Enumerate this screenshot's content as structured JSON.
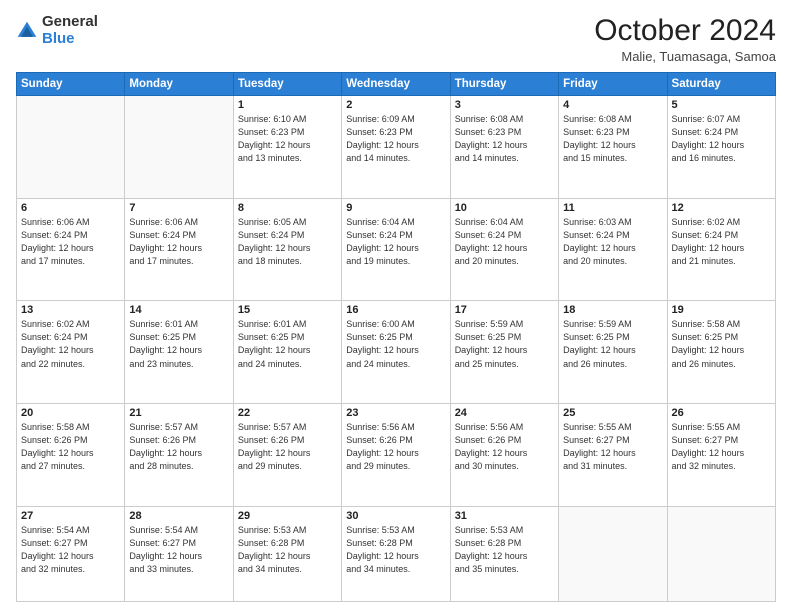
{
  "logo": {
    "general": "General",
    "blue": "Blue"
  },
  "header": {
    "month_year": "October 2024",
    "location": "Malie, Tuamasaga, Samoa"
  },
  "weekdays": [
    "Sunday",
    "Monday",
    "Tuesday",
    "Wednesday",
    "Thursday",
    "Friday",
    "Saturday"
  ],
  "weeks": [
    [
      {
        "day": "",
        "info": ""
      },
      {
        "day": "",
        "info": ""
      },
      {
        "day": "1",
        "info": "Sunrise: 6:10 AM\nSunset: 6:23 PM\nDaylight: 12 hours\nand 13 minutes."
      },
      {
        "day": "2",
        "info": "Sunrise: 6:09 AM\nSunset: 6:23 PM\nDaylight: 12 hours\nand 14 minutes."
      },
      {
        "day": "3",
        "info": "Sunrise: 6:08 AM\nSunset: 6:23 PM\nDaylight: 12 hours\nand 14 minutes."
      },
      {
        "day": "4",
        "info": "Sunrise: 6:08 AM\nSunset: 6:23 PM\nDaylight: 12 hours\nand 15 minutes."
      },
      {
        "day": "5",
        "info": "Sunrise: 6:07 AM\nSunset: 6:24 PM\nDaylight: 12 hours\nand 16 minutes."
      }
    ],
    [
      {
        "day": "6",
        "info": "Sunrise: 6:06 AM\nSunset: 6:24 PM\nDaylight: 12 hours\nand 17 minutes."
      },
      {
        "day": "7",
        "info": "Sunrise: 6:06 AM\nSunset: 6:24 PM\nDaylight: 12 hours\nand 17 minutes."
      },
      {
        "day": "8",
        "info": "Sunrise: 6:05 AM\nSunset: 6:24 PM\nDaylight: 12 hours\nand 18 minutes."
      },
      {
        "day": "9",
        "info": "Sunrise: 6:04 AM\nSunset: 6:24 PM\nDaylight: 12 hours\nand 19 minutes."
      },
      {
        "day": "10",
        "info": "Sunrise: 6:04 AM\nSunset: 6:24 PM\nDaylight: 12 hours\nand 20 minutes."
      },
      {
        "day": "11",
        "info": "Sunrise: 6:03 AM\nSunset: 6:24 PM\nDaylight: 12 hours\nand 20 minutes."
      },
      {
        "day": "12",
        "info": "Sunrise: 6:02 AM\nSunset: 6:24 PM\nDaylight: 12 hours\nand 21 minutes."
      }
    ],
    [
      {
        "day": "13",
        "info": "Sunrise: 6:02 AM\nSunset: 6:24 PM\nDaylight: 12 hours\nand 22 minutes."
      },
      {
        "day": "14",
        "info": "Sunrise: 6:01 AM\nSunset: 6:25 PM\nDaylight: 12 hours\nand 23 minutes."
      },
      {
        "day": "15",
        "info": "Sunrise: 6:01 AM\nSunset: 6:25 PM\nDaylight: 12 hours\nand 24 minutes."
      },
      {
        "day": "16",
        "info": "Sunrise: 6:00 AM\nSunset: 6:25 PM\nDaylight: 12 hours\nand 24 minutes."
      },
      {
        "day": "17",
        "info": "Sunrise: 5:59 AM\nSunset: 6:25 PM\nDaylight: 12 hours\nand 25 minutes."
      },
      {
        "day": "18",
        "info": "Sunrise: 5:59 AM\nSunset: 6:25 PM\nDaylight: 12 hours\nand 26 minutes."
      },
      {
        "day": "19",
        "info": "Sunrise: 5:58 AM\nSunset: 6:25 PM\nDaylight: 12 hours\nand 26 minutes."
      }
    ],
    [
      {
        "day": "20",
        "info": "Sunrise: 5:58 AM\nSunset: 6:26 PM\nDaylight: 12 hours\nand 27 minutes."
      },
      {
        "day": "21",
        "info": "Sunrise: 5:57 AM\nSunset: 6:26 PM\nDaylight: 12 hours\nand 28 minutes."
      },
      {
        "day": "22",
        "info": "Sunrise: 5:57 AM\nSunset: 6:26 PM\nDaylight: 12 hours\nand 29 minutes."
      },
      {
        "day": "23",
        "info": "Sunrise: 5:56 AM\nSunset: 6:26 PM\nDaylight: 12 hours\nand 29 minutes."
      },
      {
        "day": "24",
        "info": "Sunrise: 5:56 AM\nSunset: 6:26 PM\nDaylight: 12 hours\nand 30 minutes."
      },
      {
        "day": "25",
        "info": "Sunrise: 5:55 AM\nSunset: 6:27 PM\nDaylight: 12 hours\nand 31 minutes."
      },
      {
        "day": "26",
        "info": "Sunrise: 5:55 AM\nSunset: 6:27 PM\nDaylight: 12 hours\nand 32 minutes."
      }
    ],
    [
      {
        "day": "27",
        "info": "Sunrise: 5:54 AM\nSunset: 6:27 PM\nDaylight: 12 hours\nand 32 minutes."
      },
      {
        "day": "28",
        "info": "Sunrise: 5:54 AM\nSunset: 6:27 PM\nDaylight: 12 hours\nand 33 minutes."
      },
      {
        "day": "29",
        "info": "Sunrise: 5:53 AM\nSunset: 6:28 PM\nDaylight: 12 hours\nand 34 minutes."
      },
      {
        "day": "30",
        "info": "Sunrise: 5:53 AM\nSunset: 6:28 PM\nDaylight: 12 hours\nand 34 minutes."
      },
      {
        "day": "31",
        "info": "Sunrise: 5:53 AM\nSunset: 6:28 PM\nDaylight: 12 hours\nand 35 minutes."
      },
      {
        "day": "",
        "info": ""
      },
      {
        "day": "",
        "info": ""
      }
    ]
  ]
}
